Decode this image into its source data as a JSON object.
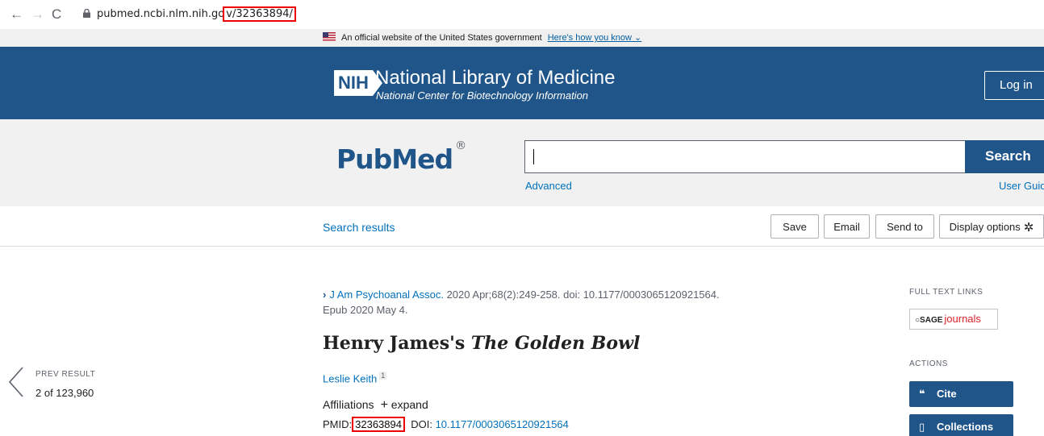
{
  "browser": {
    "url_host": "pubmed.ncbi.nlm.nih.go",
    "url_path": "v/32363894/"
  },
  "gov_banner": {
    "text": "An official website of the United States government",
    "link": "Here's how you know"
  },
  "header": {
    "nih_label": "NIH",
    "title": "National Library of Medicine",
    "subtitle": "National Center for Biotechnology Information",
    "login_label": "Log in"
  },
  "search": {
    "logo_text": "PubMed",
    "logo_mark": "®",
    "value": "",
    "button_label": "Search",
    "advanced_link": "Advanced",
    "guide_link": "User Guid"
  },
  "toolbar": {
    "back_link": "Search results",
    "save_label": "Save",
    "email_label": "Email",
    "send_label": "Send to",
    "display_label": "Display options"
  },
  "article": {
    "journal": "J Am Psychoanal Assoc.",
    "citation": " 2020 Apr;68(2):249-258. doi: 10.1177/0003065120921564.",
    "epub": "Epub 2020 May 4.",
    "title_plain": "Henry James's ",
    "title_italic": "The Golden Bowl",
    "author": "Leslie Keith",
    "author_sup": "1",
    "affiliations_label": "Affiliations",
    "expand_label": "expand",
    "pmid_label": "PMID:",
    "pmid": "32363894",
    "doi_label": "DOI:",
    "doi": "10.1177/0003065120921564"
  },
  "pager": {
    "label": "PREV RESULT",
    "count": "2 of 123,960"
  },
  "sidebar": {
    "fulltext_heading": "FULL TEXT LINKS",
    "sage_prefix": "SAGE",
    "sage_suffix": "journals",
    "actions_heading": "ACTIONS",
    "cite_label": "Cite",
    "collections_label": "Collections"
  },
  "colors": {
    "brand_blue": "#20558a",
    "link_blue": "#0071bc",
    "highlight_red": "#e00000"
  }
}
